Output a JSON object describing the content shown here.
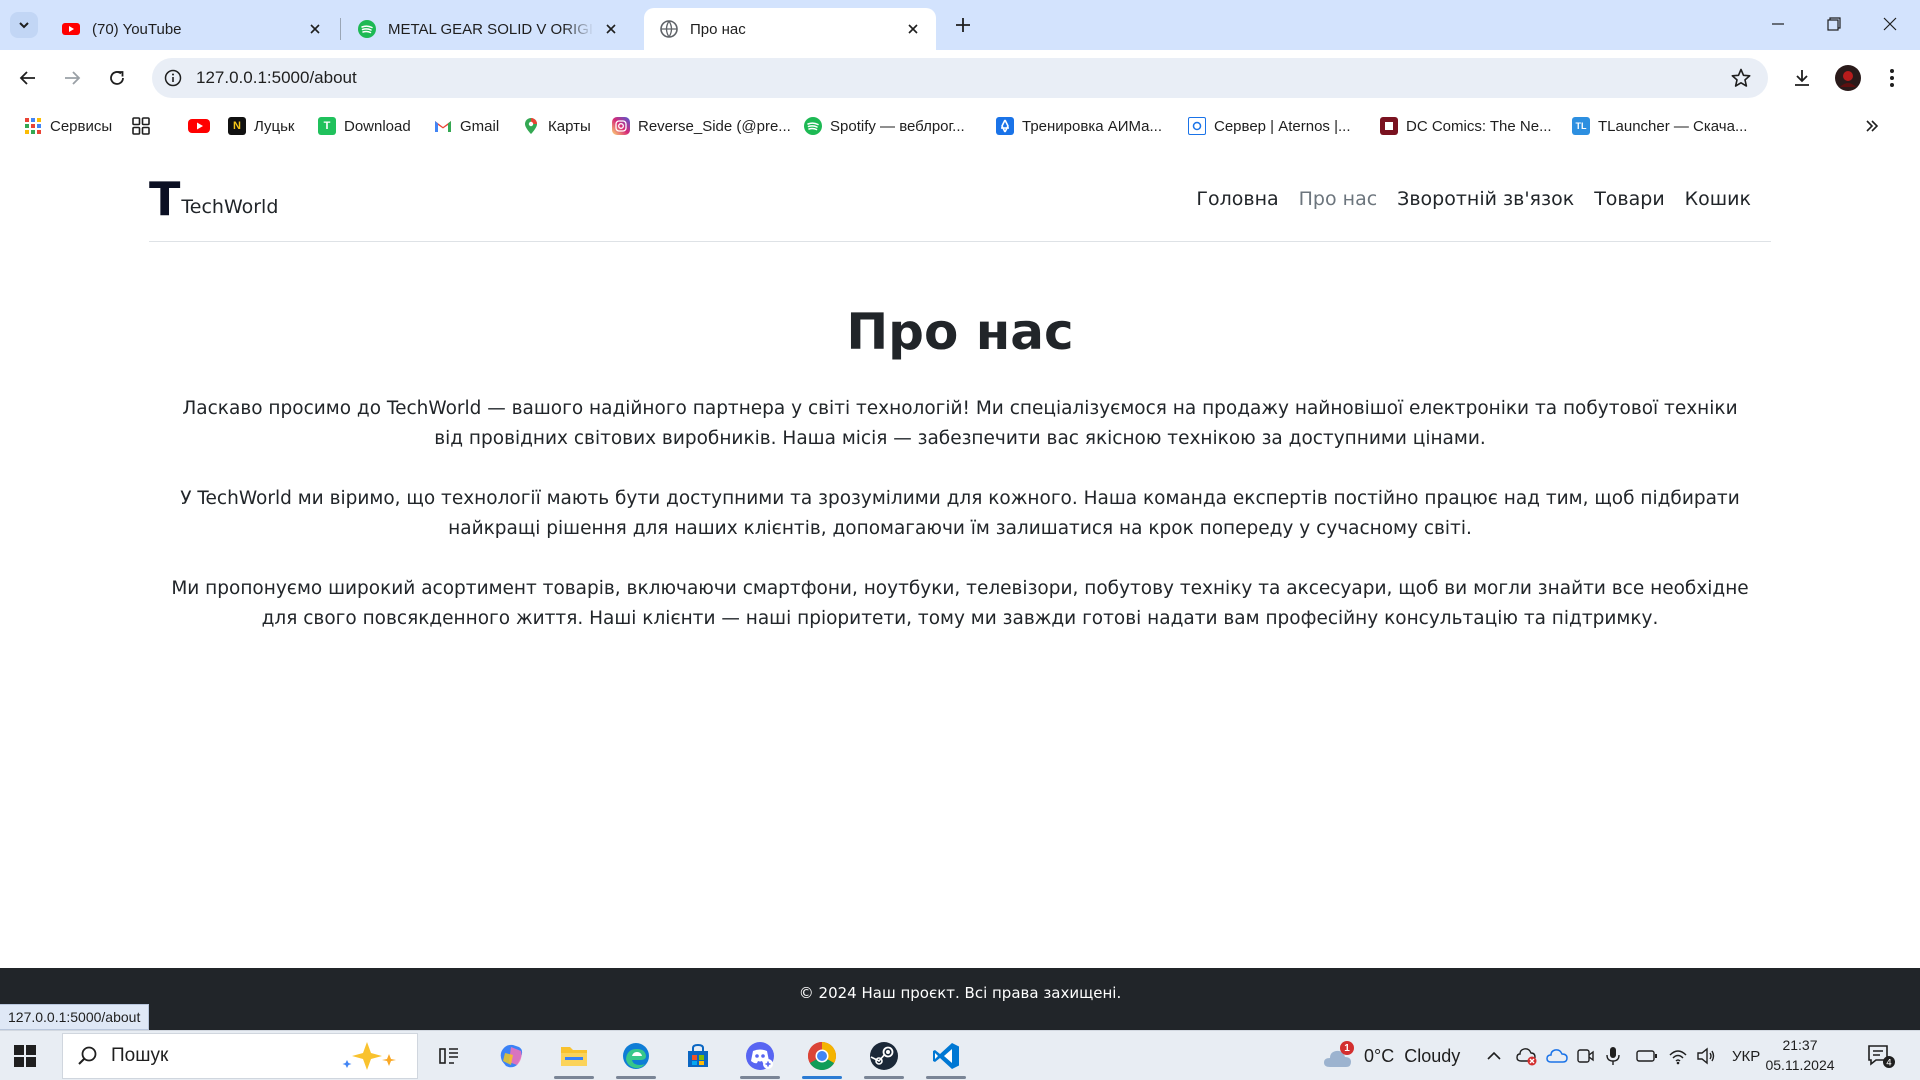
{
  "browser": {
    "tabs": [
      {
        "title": "(70) YouTube",
        "icon": "youtube-icon"
      },
      {
        "title": "METAL GEAR SOLID  V  ORIGINAL",
        "icon": "spotify-icon"
      },
      {
        "title": "Про нас",
        "icon": "globe-icon",
        "active": true
      }
    ],
    "url": "127.0.0.1:5000/about",
    "bookmarks": [
      {
        "label": "Сервисы",
        "icon": "apps-grid-icon"
      },
      {
        "label": "",
        "icon": "tab-groups-icon"
      },
      {
        "label": "",
        "icon": "youtube-icon"
      },
      {
        "label": "Луцьк",
        "icon": "n-logo-icon"
      },
      {
        "label": "Download",
        "icon": "t-logo-icon"
      },
      {
        "label": "Gmail",
        "icon": "gmail-icon"
      },
      {
        "label": "Карты",
        "icon": "maps-pin-icon"
      },
      {
        "label": "Reverse_Side (@pre...",
        "icon": "instagram-icon"
      },
      {
        "label": "Spotify — веблрог...",
        "icon": "spotify-icon"
      },
      {
        "label": "Тренировка АИМа...",
        "icon": "aim-trainer-icon"
      },
      {
        "label": "Сервер | Aternos |...",
        "icon": "aternos-icon"
      },
      {
        "label": "DC Comics: The Ne...",
        "icon": "dc-comics-icon"
      },
      {
        "label": "TLauncher — Скача...",
        "icon": "tlauncher-icon"
      }
    ],
    "status_url": "127.0.0.1:5000/about"
  },
  "site": {
    "logo_letter": "T",
    "logo_name": "TechWorld",
    "nav": [
      {
        "label": "Головна"
      },
      {
        "label": "Про нас",
        "current": true
      },
      {
        "label": "Зворотній зв'язок"
      },
      {
        "label": "Товари"
      },
      {
        "label": "Кошик"
      }
    ],
    "heading": "Про нас",
    "paragraphs": [
      "Ласкаво просимо до TechWorld — вашого надійного партнера у світі технологій! Ми спеціалізуємося на продажу найновішої електроніки та побутової техніки від провідних світових виробників. Наша місія — забезпечити вас якісною технікою за доступними цінами.",
      "У TechWorld ми віримо, що технології мають бути доступними та зрозумілими для кожного. Наша команда експертів постійно працює над тим, щоб підбирати найкращі рішення для наших клієнтів, допомагаючи їм залишатися на крок попереду у сучасному світі.",
      "Ми пропонуємо широкий асортимент товарів, включаючи смартфони, ноутбуки, телевізори, побутову техніку та аксесуари, щоб ви могли знайти все необхідне для свого повсякденного життя. Наші клієнти — наші пріоритети, тому ми завжди готові надати вам професійну консультацію та підтримку."
    ],
    "footer": "© 2024 Наш проєкт. Всі права захищені."
  },
  "taskbar": {
    "search_placeholder": "Пошук",
    "weather_badge": "1",
    "weather": "0°C  Cloudy",
    "language": "УКР",
    "time": "21:37",
    "date": "05.11.2024"
  },
  "colors": {
    "tabstrip": "#d3e3fd",
    "footer_bg": "#212529",
    "taskbar_bg": "#e8edf3",
    "nav_current": "#6c757d"
  }
}
